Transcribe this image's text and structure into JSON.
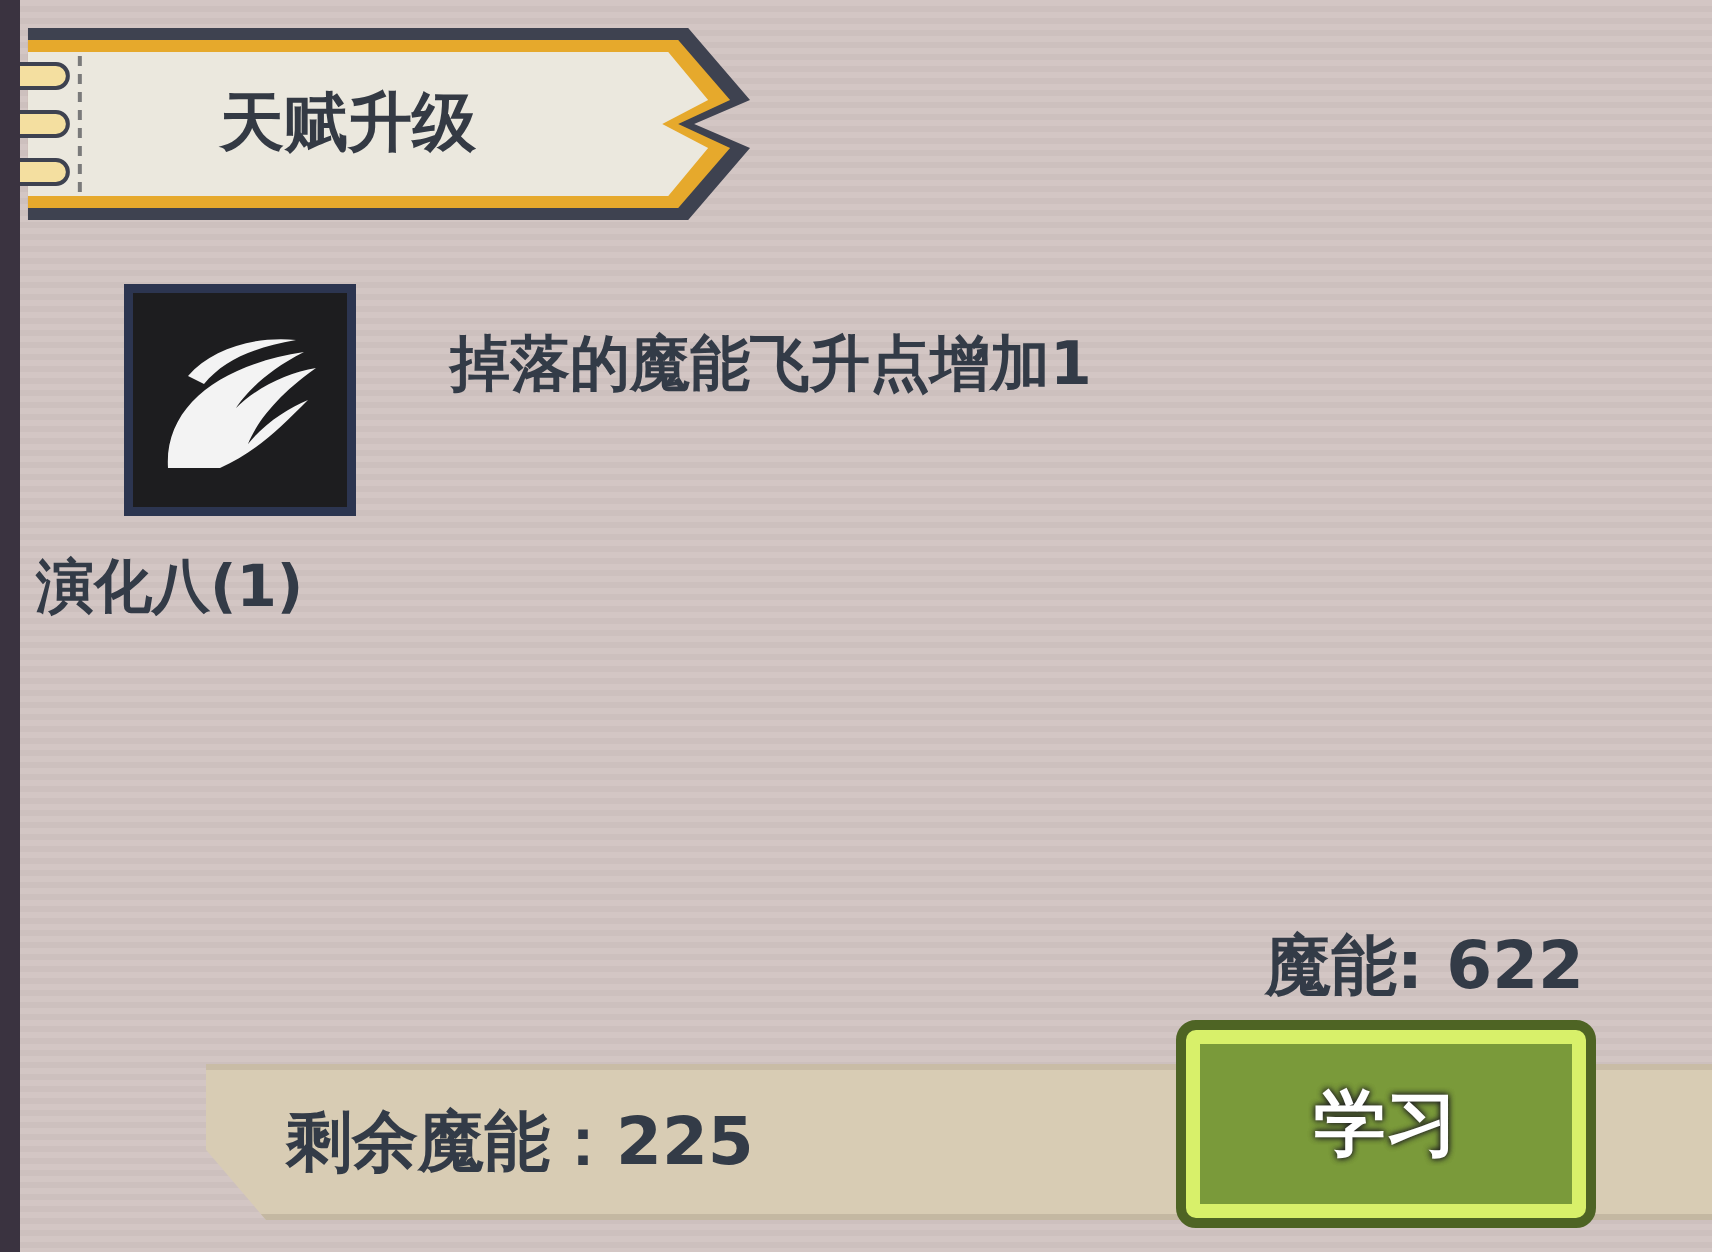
{
  "header": {
    "title": "天赋升级"
  },
  "talent": {
    "name": "演化八(1)",
    "description": "掉落的魔能飞升点增加1"
  },
  "cost": "魔能: 622",
  "learn_button": {
    "label": "学习"
  },
  "remaining": "剩余魔能：225"
}
